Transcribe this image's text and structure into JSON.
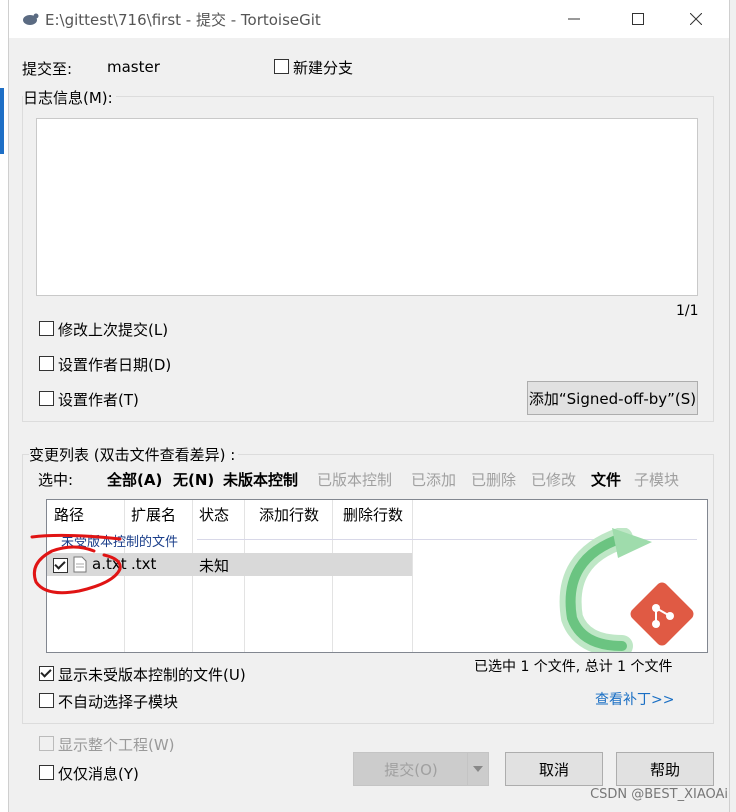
{
  "window": {
    "title": "E:\\gittest\\716\\first - 提交 - TortoiseGit"
  },
  "header": {
    "commit_to_label": "提交至:",
    "branch": "master",
    "new_branch_label": "新建分支",
    "new_branch_checked": false
  },
  "message": {
    "group_label": "日志信息(M):",
    "value": "",
    "counter": "1/1"
  },
  "options": {
    "amend_label": "修改上次提交(L)",
    "set_date_label": "设置作者日期(D)",
    "set_author_label": "设置作者(T)",
    "signed_off_label": "添加“Signed-off-by”(S)"
  },
  "changes": {
    "group_label": "变更列表 (双击文件查看差异) :",
    "select_label": "选中:",
    "filters": [
      {
        "label": "全部(A)",
        "active": true
      },
      {
        "label": "无(N)",
        "active": true
      },
      {
        "label": "未版本控制",
        "active": true
      },
      {
        "label": "已版本控制",
        "active": false
      },
      {
        "label": "已添加",
        "active": false
      },
      {
        "label": "已删除",
        "active": false
      },
      {
        "label": "已修改",
        "active": false
      },
      {
        "label": "文件",
        "active": true
      },
      {
        "label": "子模块",
        "active": false
      }
    ],
    "columns": [
      "路径",
      "扩展名",
      "状态",
      "添加行数",
      "删除行数"
    ],
    "group_row": "未受版本控制的文件",
    "rows": [
      {
        "path": "a.txt",
        "ext": ".txt",
        "status": "未知",
        "added": "",
        "deleted": "",
        "checked": true
      }
    ],
    "show_unversioned_label": "显示未受版本控制的文件(U)",
    "no_autoselect_label": "不自动选择子模块",
    "summary": "已选中 1 个文件, 总计 1 个文件",
    "view_patch_link": "查看补丁>>"
  },
  "footer": {
    "show_whole_project_label": "显示整个工程(W)",
    "message_only_label": "仅仅消息(Y)",
    "commit_button": "提交(O)",
    "cancel_button": "取消",
    "help_button": "帮助"
  },
  "watermark": "CSDN @BEST_XIAOAi",
  "colors": {
    "accent": "#1a6fc4",
    "annotation": "#e01414",
    "logo_green": "#3cb371",
    "git_red": "#e05a44"
  }
}
